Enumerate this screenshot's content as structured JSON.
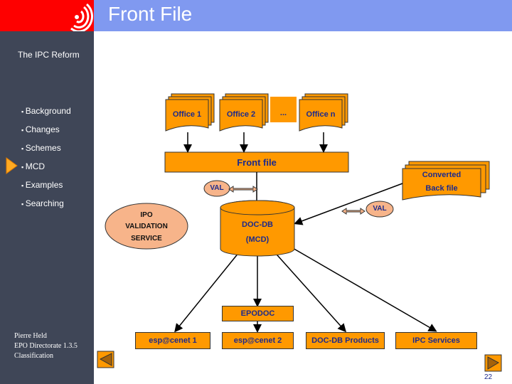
{
  "header": {
    "title": "Front File"
  },
  "sidebar": {
    "subtitle": "The IPC Reform",
    "items": [
      "Background",
      "Changes",
      "Schemes",
      "MCD",
      "Examples",
      "Searching"
    ],
    "current": "MCD",
    "footer": [
      "Pierre Held",
      "EPO Directorate 1.3.5",
      "Classification"
    ]
  },
  "diagram": {
    "offices": [
      "Office 1",
      "Office 2",
      "...",
      "Office n"
    ],
    "front_file": "Front file",
    "converted": [
      "Converted",
      "Back file"
    ],
    "val": "VAL",
    "ipo": [
      "IPO",
      "VALIDATION",
      "SERVICE"
    ],
    "docdb": [
      "DOC-DB",
      "(MCD)"
    ],
    "epodoc": "EPODOC",
    "outputs": [
      "esp@cenet 1",
      "esp@cenet 2",
      "DOC-DB Products",
      "IPC Services"
    ]
  },
  "page_number": "22",
  "colors": {
    "orange": "#ff9900",
    "salmon": "#f7b48a",
    "sidebar": "#3f4657",
    "header": "#8099f0",
    "logo_bg": "#fe0000"
  }
}
